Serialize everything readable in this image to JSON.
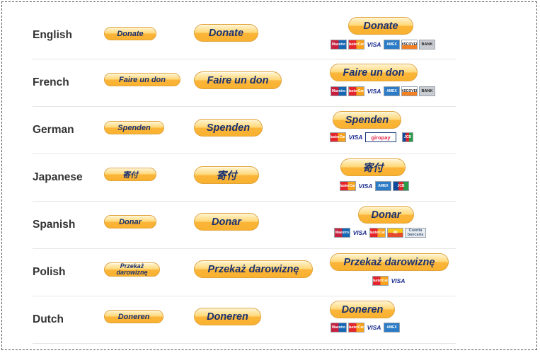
{
  "rows": [
    {
      "lang": "English",
      "small": "Donate",
      "medium": "Donate",
      "large": "Donate",
      "cards": [
        "Maestro",
        "MasterCard",
        "VISA",
        "AMEX",
        "DISCOVER",
        "BANK"
      ]
    },
    {
      "lang": "French",
      "small": "Faire un don",
      "medium": "Faire un don",
      "large": "Faire un don",
      "cards": [
        "Maestro",
        "MasterCard",
        "VISA",
        "AMEX",
        "DISCOVER",
        "BANK"
      ]
    },
    {
      "lang": "German",
      "small": "Spenden",
      "medium": "Spenden",
      "large": "Spenden",
      "cards": [
        "MasterCard",
        "VISA",
        "giropay",
        "JCB"
      ]
    },
    {
      "lang": "Japanese",
      "small": "寄付",
      "medium": "寄付",
      "large": "寄付",
      "cards": [
        "MasterCard",
        "VISA",
        "AMEX",
        "JCB"
      ]
    },
    {
      "lang": "Spanish",
      "small": "Donar",
      "medium": "Donar",
      "large": "Donar",
      "cards": [
        "Maestro",
        "VISA",
        "MasterCard",
        "4B",
        "Cuenta bancaria"
      ]
    },
    {
      "lang": "Polish",
      "small": "Przekaż darowiznę",
      "medium": "Przekaż darowiznę",
      "large": "Przekaż darowiznę",
      "cards": [
        "MasterCard",
        "VISA"
      ]
    },
    {
      "lang": "Dutch",
      "small": "Doneren",
      "medium": "Doneren",
      "large": "Doneren",
      "cards": [
        "Maestro",
        "MasterCard",
        "VISA",
        "AMEX"
      ]
    }
  ]
}
